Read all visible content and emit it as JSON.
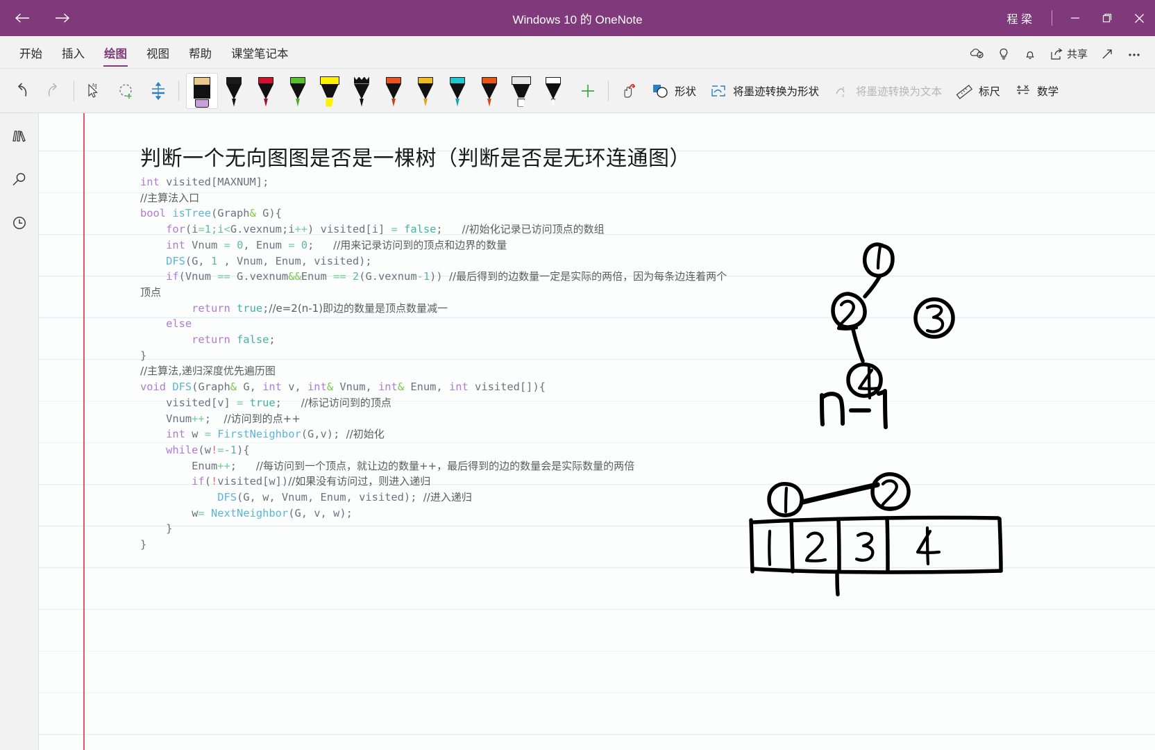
{
  "titlebar": {
    "back_icon": "arrow-left-icon",
    "forward_icon": "arrow-right-icon",
    "title": "Windows 10 的 OneNote",
    "account": "程 梁",
    "minimize": "—",
    "restore": "restore-icon",
    "close": "×"
  },
  "ribbon": {
    "tabs": [
      {
        "label": "开始",
        "active": false
      },
      {
        "label": "插入",
        "active": false
      },
      {
        "label": "绘图",
        "active": true
      },
      {
        "label": "视图",
        "active": false
      },
      {
        "label": "帮助",
        "active": false
      },
      {
        "label": "课堂笔记本",
        "active": false
      }
    ],
    "right_items": [
      {
        "label": "",
        "icon": "cloud-sync-icon"
      },
      {
        "label": "",
        "icon": "lightbulb-icon"
      },
      {
        "label": "",
        "icon": "bell-icon"
      },
      {
        "label": "共享",
        "icon": "share-icon"
      },
      {
        "label": "",
        "icon": "expand-icon"
      },
      {
        "label": "",
        "icon": "more-ellipsis-icon"
      }
    ]
  },
  "toolbar": {
    "undo": "undo-icon",
    "redo": "redo-icon",
    "lasso_text": "select-text-icon",
    "lasso": "lasso-select-icon",
    "thickness": "ink-thickness-icon",
    "add_pen": "+",
    "items": [
      {
        "label": "",
        "icon": "draw-with-touch-icon"
      },
      {
        "label": "形状",
        "icon": "shapes-icon"
      },
      {
        "label": "将墨迹转换为形状",
        "icon": "ink-to-shape-icon"
      },
      {
        "label": "将墨迹转换为文本",
        "icon": "ink-to-text-icon",
        "disabled": true
      },
      {
        "label": "标尺",
        "icon": "ruler-icon"
      },
      {
        "label": "数学",
        "icon": "math-icon"
      }
    ],
    "pens": [
      {
        "name": "eraser",
        "type": "eraser",
        "cap": "#E8C98D",
        "tip": "#C9A0DC",
        "selected": true
      },
      {
        "name": "pen-black",
        "type": "pen",
        "cap": "#1a1a1a",
        "tip": "#111111"
      },
      {
        "name": "pen-red",
        "type": "pen",
        "cap": "#D0112B",
        "tip": "#A01029"
      },
      {
        "name": "pen-green",
        "type": "pen",
        "cap": "#57C22B",
        "tip": "#4FAE28"
      },
      {
        "name": "highlighter-yellow",
        "type": "marker",
        "cap": "#FFF200",
        "tip": "#FFF200"
      },
      {
        "name": "pencil-black",
        "type": "pencil",
        "cap": "#111111",
        "tip": "#111111"
      },
      {
        "name": "pen-orange",
        "type": "pen",
        "cap": "#E8521F",
        "tip": "#C0441A"
      },
      {
        "name": "pen-gold",
        "type": "pen",
        "cap": "#EFBB22",
        "tip": "#D9A51C"
      },
      {
        "name": "pen-cyan",
        "type": "pen",
        "cap": "#1FC8CF",
        "tip": "#15A9B0"
      },
      {
        "name": "pen-orange-2",
        "type": "pen",
        "cap": "#EA5514",
        "tip": "#D44A12"
      },
      {
        "name": "marker-white",
        "type": "marker",
        "cap": "#E8E8E8",
        "tip": "#FFFFFF"
      },
      {
        "name": "pen-white",
        "type": "pen",
        "cap": "#FFFFFF",
        "tip": "#FFFFFF"
      }
    ]
  },
  "leftrail": [
    {
      "name": "notebooks",
      "icon": "notebooks-icon"
    },
    {
      "name": "search",
      "icon": "search-icon"
    },
    {
      "name": "recent",
      "icon": "clock-recent-icon"
    }
  ],
  "note": {
    "title": "判断一个无向图图是否是一棵树（判断是否是无环连通图）",
    "code_lines": [
      [
        {
          "t": "int",
          "c": "kw"
        },
        {
          "t": " visited[MAXNUM];",
          "c": "pln"
        }
      ],
      [
        {
          "t": "//主算法入口",
          "c": "cmt"
        }
      ],
      [
        {
          "t": "bool",
          "c": "kw"
        },
        {
          "t": " ",
          "c": "pln"
        },
        {
          "t": "isTree",
          "c": "fn"
        },
        {
          "t": "(Graph",
          "c": "pln"
        },
        {
          "t": "&",
          "c": "amp"
        },
        {
          "t": " G){",
          "c": "pln"
        }
      ],
      [
        {
          "t": "    ",
          "c": "pln"
        },
        {
          "t": "for",
          "c": "kw"
        },
        {
          "t": "(i",
          "c": "pln"
        },
        {
          "t": "=",
          "c": "op"
        },
        {
          "t": "1;i",
          "c": "num"
        },
        {
          "t": "<",
          "c": "op"
        },
        {
          "t": "G.vexnum;i",
          "c": "pln"
        },
        {
          "t": "++",
          "c": "op"
        },
        {
          "t": ") visited[i] ",
          "c": "pln"
        },
        {
          "t": "=",
          "c": "op"
        },
        {
          "t": " ",
          "c": "pln"
        },
        {
          "t": "false",
          "c": "bool"
        },
        {
          "t": ";   ",
          "c": "pln"
        },
        {
          "t": "//初始化记录已访问顶点的数组",
          "c": "cmt"
        }
      ],
      [
        {
          "t": "    ",
          "c": "pln"
        },
        {
          "t": "int",
          "c": "kw"
        },
        {
          "t": " Vnum ",
          "c": "pln"
        },
        {
          "t": "=",
          "c": "op"
        },
        {
          "t": " ",
          "c": "pln"
        },
        {
          "t": "0",
          "c": "num"
        },
        {
          "t": ", Enum ",
          "c": "pln"
        },
        {
          "t": "=",
          "c": "op"
        },
        {
          "t": " ",
          "c": "pln"
        },
        {
          "t": "0",
          "c": "num"
        },
        {
          "t": ";   ",
          "c": "pln"
        },
        {
          "t": "//用来记录访问到的顶点和边界的数量",
          "c": "cmt"
        }
      ],
      [
        {
          "t": "    ",
          "c": "pln"
        },
        {
          "t": "DFS",
          "c": "fn"
        },
        {
          "t": "(G, ",
          "c": "pln"
        },
        {
          "t": "1",
          "c": "num"
        },
        {
          "t": " , Vnum, Enum, visited);",
          "c": "pln"
        }
      ],
      [
        {
          "t": "    ",
          "c": "pln"
        },
        {
          "t": "if",
          "c": "kw"
        },
        {
          "t": "(Vnum ",
          "c": "pln"
        },
        {
          "t": "==",
          "c": "op"
        },
        {
          "t": " G.vexnum",
          "c": "pln"
        },
        {
          "t": "&&",
          "c": "amp"
        },
        {
          "t": "Enum ",
          "c": "pln"
        },
        {
          "t": "==",
          "c": "op"
        },
        {
          "t": " ",
          "c": "pln"
        },
        {
          "t": "2",
          "c": "num"
        },
        {
          "t": "(G.vexnum",
          "c": "pln"
        },
        {
          "t": "-",
          "c": "op"
        },
        {
          "t": "1",
          "c": "num"
        },
        {
          "t": ")) ",
          "c": "pln"
        },
        {
          "t": "//最后得到的边数量一定是实际的两倍，因为每条边连着两个顶点",
          "c": "cmt"
        }
      ],
      [
        {
          "t": "        ",
          "c": "pln"
        },
        {
          "t": "return",
          "c": "kw"
        },
        {
          "t": " ",
          "c": "pln"
        },
        {
          "t": "true",
          "c": "bool"
        },
        {
          "t": ";",
          "c": "pln"
        },
        {
          "t": "//e=2(n-1)即边的数量是顶点数量减一",
          "c": "cmt"
        }
      ],
      [
        {
          "t": "    ",
          "c": "pln"
        },
        {
          "t": "else",
          "c": "kw"
        }
      ],
      [
        {
          "t": "        ",
          "c": "pln"
        },
        {
          "t": "return",
          "c": "kw"
        },
        {
          "t": " ",
          "c": "pln"
        },
        {
          "t": "false",
          "c": "bool"
        },
        {
          "t": ";",
          "c": "pln"
        }
      ],
      [
        {
          "t": "}",
          "c": "pln"
        }
      ],
      [
        {
          "t": "//主算法,递归深度优先遍历图",
          "c": "cmt"
        }
      ],
      [
        {
          "t": "void",
          "c": "kw"
        },
        {
          "t": " ",
          "c": "pln"
        },
        {
          "t": "DFS",
          "c": "fn"
        },
        {
          "t": "(Graph",
          "c": "pln"
        },
        {
          "t": "&",
          "c": "amp"
        },
        {
          "t": " G, ",
          "c": "pln"
        },
        {
          "t": "int",
          "c": "kw"
        },
        {
          "t": " v, ",
          "c": "pln"
        },
        {
          "t": "int",
          "c": "kw"
        },
        {
          "t": "&",
          "c": "amp"
        },
        {
          "t": " Vnum, ",
          "c": "pln"
        },
        {
          "t": "int",
          "c": "kw"
        },
        {
          "t": "&",
          "c": "amp"
        },
        {
          "t": " Enum, ",
          "c": "pln"
        },
        {
          "t": "int",
          "c": "kw"
        },
        {
          "t": " visited[]){",
          "c": "pln"
        }
      ],
      [
        {
          "t": "    visited[v] ",
          "c": "pln"
        },
        {
          "t": "=",
          "c": "op"
        },
        {
          "t": " ",
          "c": "pln"
        },
        {
          "t": "true",
          "c": "bool"
        },
        {
          "t": ";   ",
          "c": "pln"
        },
        {
          "t": "//标记访问到的顶点",
          "c": "cmt"
        }
      ],
      [
        {
          "t": "    Vnum",
          "c": "pln"
        },
        {
          "t": "++",
          "c": "op"
        },
        {
          "t": ";  ",
          "c": "pln"
        },
        {
          "t": "//访问到的点++",
          "c": "cmt"
        }
      ],
      [
        {
          "t": "    ",
          "c": "pln"
        },
        {
          "t": "int",
          "c": "kw"
        },
        {
          "t": " w ",
          "c": "pln"
        },
        {
          "t": "=",
          "c": "op"
        },
        {
          "t": " ",
          "c": "pln"
        },
        {
          "t": "FirstNeighbor",
          "c": "fn"
        },
        {
          "t": "(G,v); ",
          "c": "pln"
        },
        {
          "t": "//初始化",
          "c": "cmt"
        }
      ],
      [
        {
          "t": "    ",
          "c": "pln"
        },
        {
          "t": "while",
          "c": "kw"
        },
        {
          "t": "(w",
          "c": "pln"
        },
        {
          "t": "!",
          "c": "bang"
        },
        {
          "t": "=",
          "c": "op"
        },
        {
          "t": "-1",
          "c": "num"
        },
        {
          "t": "){",
          "c": "pln"
        }
      ],
      [
        {
          "t": "        Enum",
          "c": "pln"
        },
        {
          "t": "++",
          "c": "op"
        },
        {
          "t": ";   ",
          "c": "pln"
        },
        {
          "t": "//每访问到一个顶点，就让边的数量++，最后得到的边的数量会是实际数量的两倍",
          "c": "cmt"
        }
      ],
      [
        {
          "t": "        ",
          "c": "pln"
        },
        {
          "t": "if",
          "c": "kw"
        },
        {
          "t": "(",
          "c": "pln"
        },
        {
          "t": "!",
          "c": "bang"
        },
        {
          "t": "visited[w])",
          "c": "pln"
        },
        {
          "t": "//如果没有访问过，则进入递归",
          "c": "cmt"
        }
      ],
      [
        {
          "t": "            ",
          "c": "pln"
        },
        {
          "t": "DFS",
          "c": "fn"
        },
        {
          "t": "(G, w, Vnum, Enum, visited); ",
          "c": "pln"
        },
        {
          "t": "//进入递归",
          "c": "cmt"
        }
      ],
      [
        {
          "t": "        w",
          "c": "pln"
        },
        {
          "t": "=",
          "c": "op"
        },
        {
          "t": " ",
          "c": "pln"
        },
        {
          "t": "NextNeighbor",
          "c": "fn"
        },
        {
          "t": "(G, v, w);",
          "c": "pln"
        }
      ],
      [
        {
          "t": "    }",
          "c": "pln"
        }
      ],
      [
        {
          "t": "}",
          "c": "pln"
        }
      ]
    ],
    "ink": {
      "graph1": {
        "nodes": [
          "1",
          "2",
          "3",
          "4"
        ],
        "edges": [
          [
            "1",
            "2"
          ],
          [
            "2",
            "4"
          ]
        ],
        "isolated": [
          "3"
        ]
      },
      "formula": "n-1",
      "graph2": {
        "nodes": [
          "1",
          "2"
        ],
        "edges": [
          [
            "1",
            "2"
          ]
        ]
      },
      "table_cells": [
        "1",
        "2",
        "3",
        "4"
      ]
    }
  }
}
